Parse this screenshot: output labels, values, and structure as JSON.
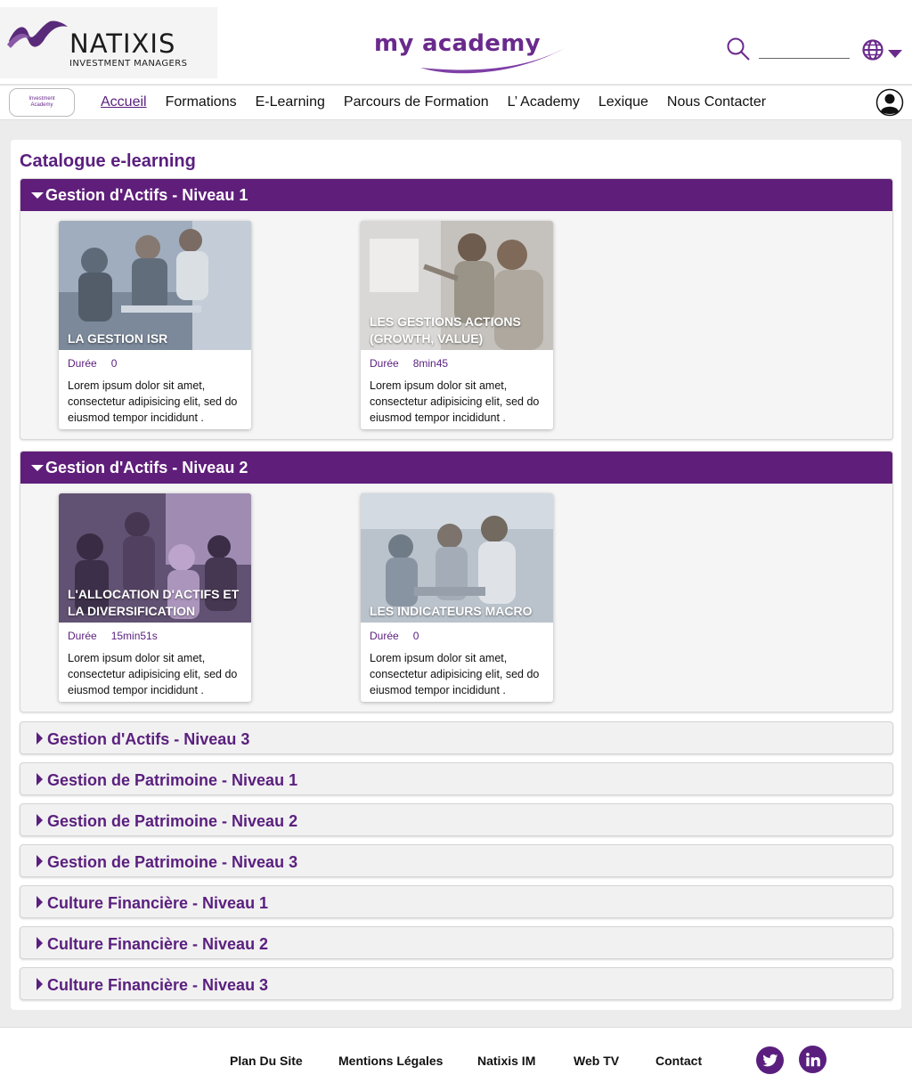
{
  "brand": {
    "company_name": "NATIXIS",
    "company_sub": "INVESTMENT MANAGERS",
    "academy_logo": "my academy",
    "nav_logo_line1": "Investment",
    "nav_logo_line2": "Academy",
    "accent_color": "#5f1e7a"
  },
  "search": {
    "placeholder": "",
    "value": ""
  },
  "nav": {
    "items": [
      {
        "label": "Accueil"
      },
      {
        "label": "Formations"
      },
      {
        "label": "E-Learning"
      },
      {
        "label": "Parcours de Formation"
      },
      {
        "label": "L’ Academy"
      },
      {
        "label": "Lexique"
      },
      {
        "label": "Nous Contacter"
      }
    ],
    "active": "Accueil"
  },
  "page": {
    "title": "Catalogue e-learning"
  },
  "duration_label": "Durée",
  "open_sections": [
    {
      "title": "Gestion d'Actifs - Niveau 1",
      "cards": [
        {
          "title": "LA GESTION ISR",
          "duration": "0",
          "description": "Lorem ipsum dolor sit amet, consectetur adipisicing elit, sed do eiusmod tempor incididunt ."
        },
        {
          "title": "LES GESTIONS ACTIONS (GROWTH, VALUE)",
          "duration": "8min45",
          "description": "Lorem ipsum dolor sit amet, consectetur adipisicing elit, sed do eiusmod tempor incididunt ."
        }
      ]
    },
    {
      "title": "Gestion d'Actifs - Niveau 2",
      "cards": [
        {
          "title": "L'ALLOCATION D'ACTIFS ET LA DIVERSIFICATION",
          "duration": "15min51s",
          "description": "Lorem ipsum dolor sit amet, consectetur adipisicing elit, sed do eiusmod tempor incididunt ."
        },
        {
          "title": "LES INDICATEURS MACRO",
          "duration": "0",
          "description": "Lorem ipsum dolor sit amet, consectetur adipisicing elit, sed do eiusmod tempor incididunt ."
        }
      ]
    }
  ],
  "closed_sections": [
    {
      "title": "Gestion d'Actifs - Niveau 3"
    },
    {
      "title": "Gestion de Patrimoine - Niveau 1"
    },
    {
      "title": "Gestion de Patrimoine - Niveau 2"
    },
    {
      "title": "Gestion de Patrimoine - Niveau 3"
    },
    {
      "title": "Culture Financière - Niveau 1"
    },
    {
      "title": "Culture Financière - Niveau 2"
    },
    {
      "title": "Culture Financière - Niveau 3"
    }
  ],
  "footer": {
    "links": [
      {
        "label": "Plan Du Site"
      },
      {
        "label": "Mentions Légales"
      },
      {
        "label": "Natixis IM"
      },
      {
        "label": "Web TV"
      },
      {
        "label": "Contact"
      }
    ],
    "social": [
      {
        "icon": "twitter-icon"
      },
      {
        "icon": "linkedin-icon"
      }
    ]
  }
}
